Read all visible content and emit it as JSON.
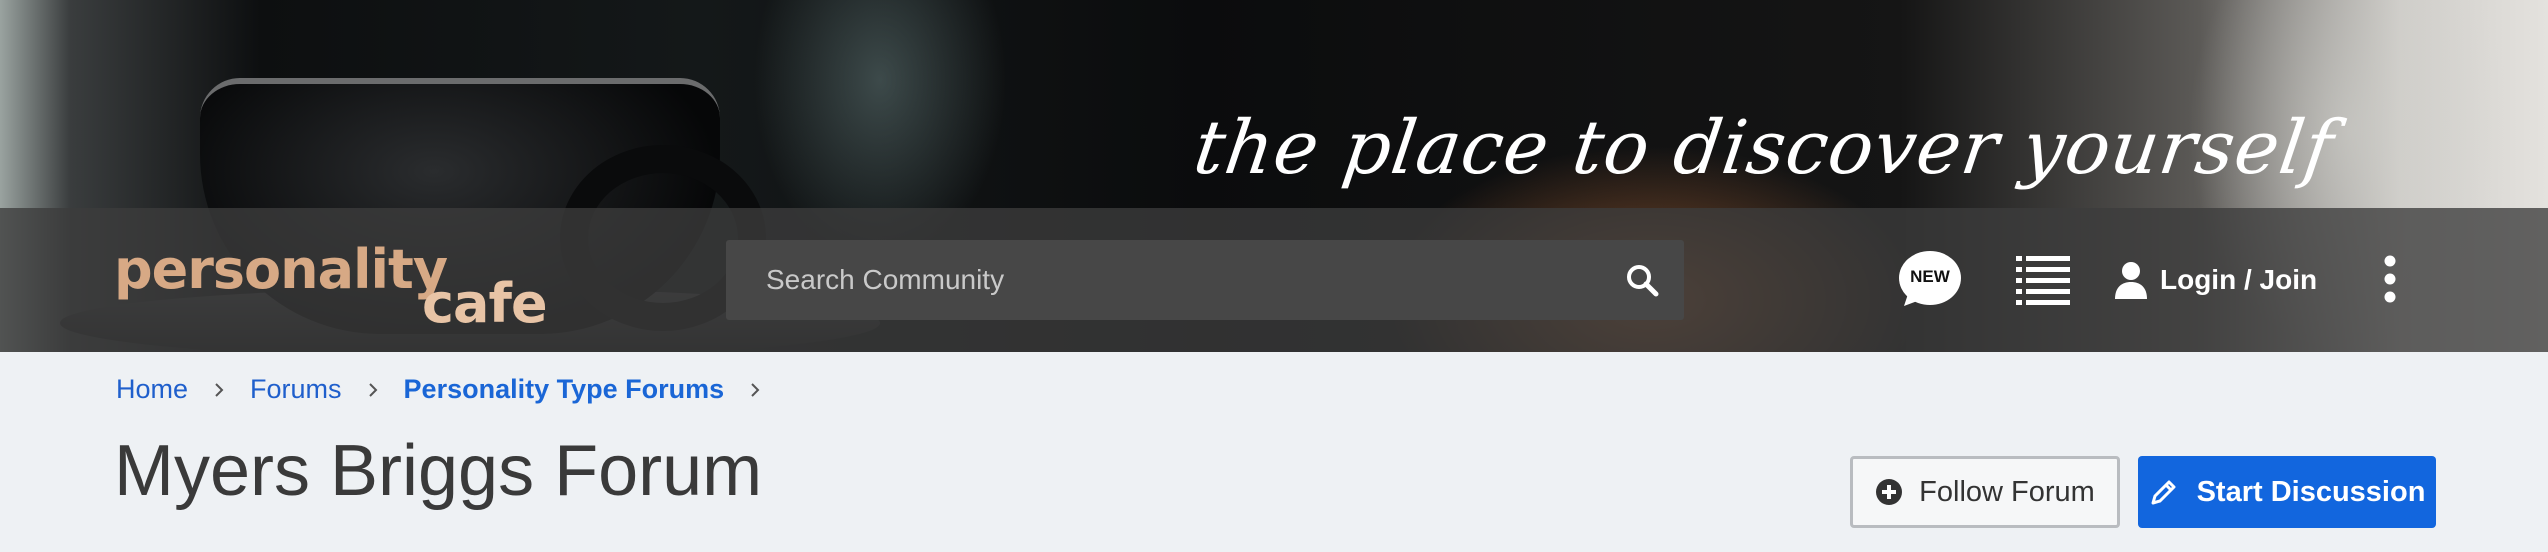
{
  "header": {
    "tagline": "the place to discover yourself",
    "logo": {
      "line1": "personality",
      "line2": "cafe"
    },
    "search": {
      "placeholder": "Search Community",
      "value": ""
    },
    "new_badge": "NEW",
    "login_label": "Login / Join",
    "icons": {
      "search": "search-icon",
      "new": "speech-bubble-icon",
      "list": "list-icon",
      "user": "user-icon",
      "more": "kebab-menu-icon"
    }
  },
  "breadcrumb": {
    "items": [
      "Home",
      "Forums",
      "Personality Type Forums"
    ]
  },
  "page": {
    "title": "Myers Briggs Forum",
    "follow_label": "Follow Forum",
    "start_label": "Start Discussion"
  },
  "colors": {
    "accent": "#1266de",
    "link": "#1f5fcc",
    "logo": "#d7a985",
    "page_bg": "#eef1f4"
  }
}
